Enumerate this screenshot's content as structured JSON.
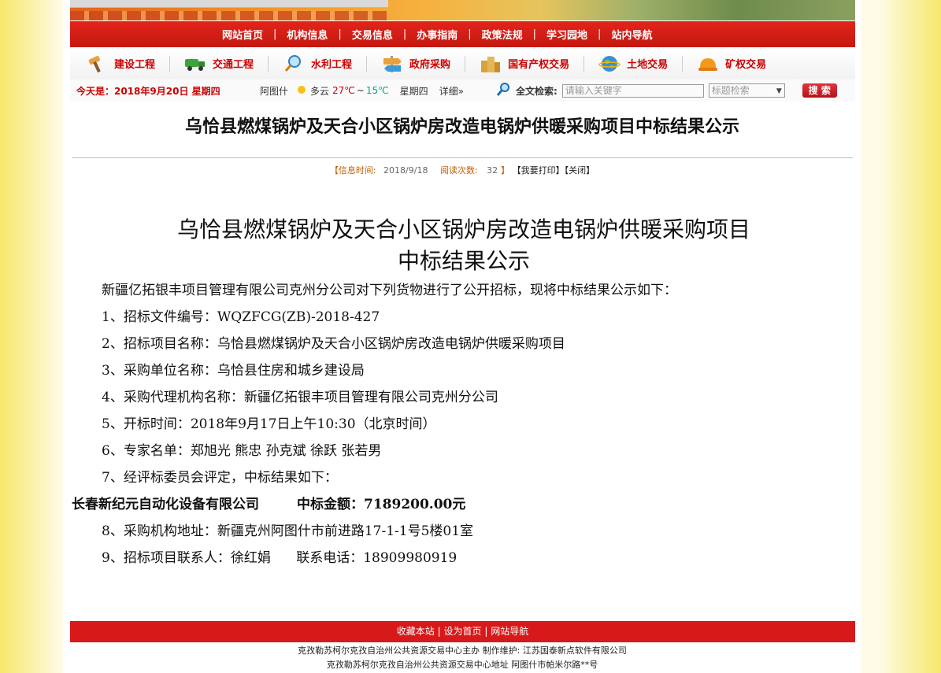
{
  "nav": {
    "items": [
      "网站首页",
      "机构信息",
      "交易信息",
      "办事指南",
      "政策法规",
      "学习园地",
      "站内导航"
    ]
  },
  "categories": [
    {
      "label": "建设工程",
      "icon": "hammer-icon"
    },
    {
      "label": "交通工程",
      "icon": "truck-icon"
    },
    {
      "label": "水利工程",
      "icon": "magnifier-icon"
    },
    {
      "label": "政府采购",
      "icon": "signpost-icon"
    },
    {
      "label": "国有产权交易",
      "icon": "buildings-icon"
    },
    {
      "label": "土地交易",
      "icon": "globe-icon"
    },
    {
      "label": "矿权交易",
      "icon": "helmet-icon"
    }
  ],
  "infobar": {
    "today": "今天是：2018年9月20日 星期四",
    "city": "阿图什",
    "weather": "多云",
    "temp_high": "27℃",
    "temp_sep": "~",
    "temp_low": "15℃",
    "weekday": "星期四",
    "detail": "详细»",
    "search_label": "全文检索:",
    "search_placeholder": "请输入关键字",
    "select_value": "标题检索",
    "search_button": "搜 索"
  },
  "article": {
    "title": "乌恰县燃煤锅炉及天合小区锅炉房改造电锅炉供暖采购项目中标结果公示",
    "meta_open": "【",
    "meta_time_label": "信息时间:",
    "meta_time": "2018/9/18",
    "meta_reads_label": "阅读次数:",
    "meta_reads": "32",
    "meta_close": "】",
    "print_link": "【我要打印】",
    "close_link": "【关闭】",
    "heading_line1": "乌恰县燃煤锅炉及天合小区锅炉房改造电锅炉供暖采购项目",
    "heading_line2": "中标结果公示",
    "intro": "新疆亿拓银丰项目管理有限公司克州分公司对下列货物进行了公开招标，现将中标结果公示如下：",
    "items": [
      "1、招标文件编号：WQZFCG(ZB)-2018-427",
      "2、招标项目名称：乌恰县燃煤锅炉及天合小区锅炉房改造电锅炉供暖采购项目",
      "3、采购单位名称：乌恰县住房和城乡建设局",
      "4、采购代理机构名称：新疆亿拓银丰项目管理有限公司克州分公司",
      "5、开标时间：2018年9月17日上午10:30（北京时间）",
      "6、专家名单：郑旭光 熊忠 孙克斌 徐跃 张若男",
      "7、经评标委员会评定，中标结果如下："
    ],
    "winner_company": "长春新纪元自动化设备有限公司",
    "winner_amount": "中标金额：7189200.00元",
    "items_after": [
      "8、采购机构地址：新疆克州阿图什市前进路17-1-1号5楼01室",
      "9、招标项目联系人：徐红娟      联系电话：18909980919"
    ]
  },
  "footer": {
    "link1": "收藏本站",
    "link2": "设为首页",
    "link3": "网站导航",
    "sep": "|",
    "line1": "克孜勒苏柯尔克孜自治州公共资源交易中心主办 制作维护: 江苏国泰新点软件有限公司",
    "line2": "克孜勒苏柯尔克孜自治州公共资源交易中心地址 阿图什市帕米尔路**号"
  }
}
